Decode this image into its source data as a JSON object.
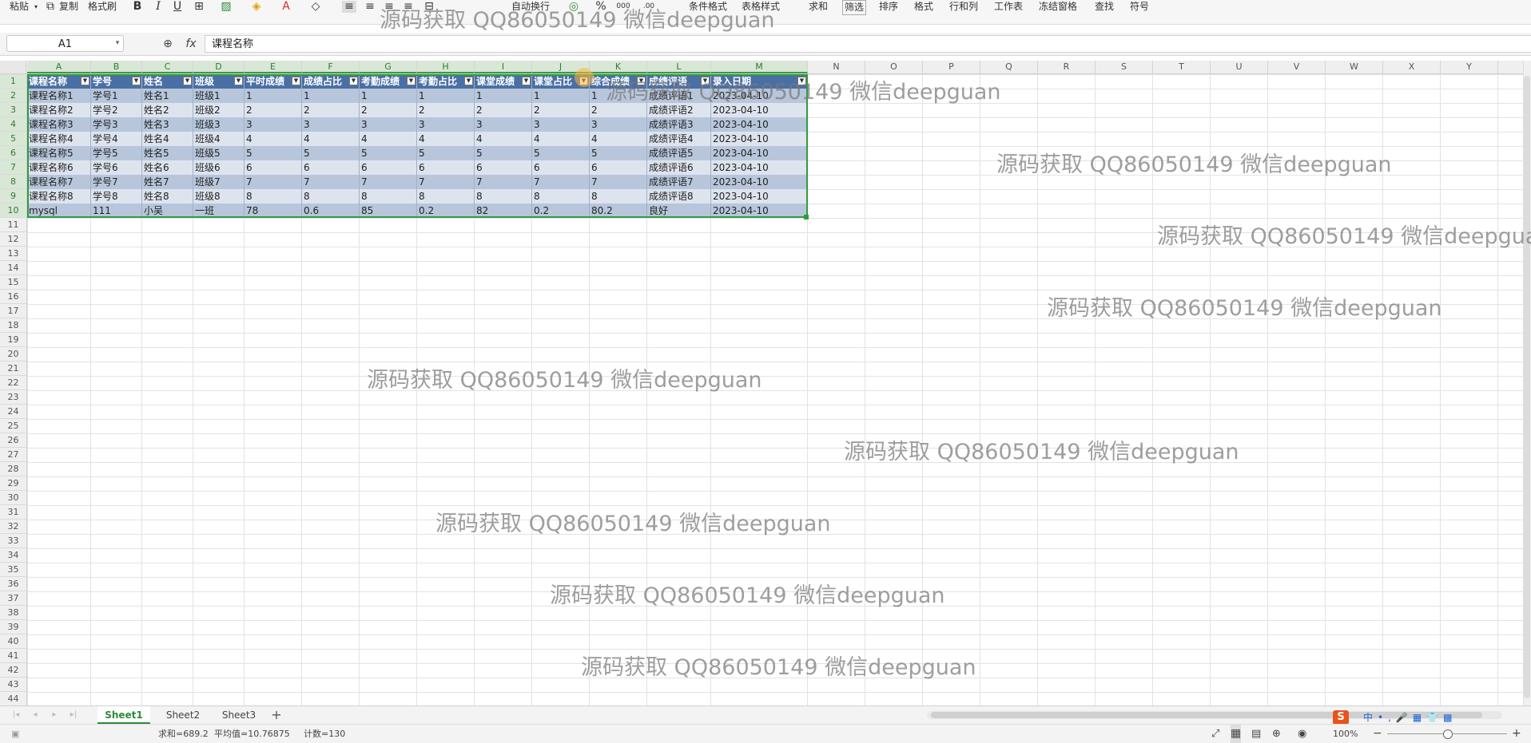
{
  "ribbon": {
    "paste": "粘贴",
    "copy": "复制",
    "format_painter": "格式刷",
    "wrap_text": "自动换行",
    "conditional_format": "条件格式",
    "table_style": "表格样式",
    "sum": "求和",
    "filter": "筛选",
    "sort": "排序",
    "format": "格式",
    "rows_cols": "行和列",
    "worksheet": "工作表",
    "freeze": "冻结窗格",
    "find": "查找",
    "symbol": "符号"
  },
  "formula_bar": {
    "name_box": "A1",
    "fx": "fx",
    "value": "课程名称"
  },
  "columns": [
    "A",
    "B",
    "C",
    "D",
    "E",
    "F",
    "G",
    "H",
    "I",
    "J",
    "K",
    "L",
    "M",
    "N",
    "O",
    "P",
    "Q",
    "R",
    "S",
    "T",
    "U",
    "V",
    "W",
    "X",
    "Y"
  ],
  "row_numbers": [
    "1",
    "2",
    "3",
    "4",
    "5",
    "6",
    "7",
    "8",
    "9",
    "10",
    "11",
    "12",
    "13",
    "14",
    "15",
    "16",
    "17",
    "18",
    "19",
    "20",
    "21",
    "22",
    "23",
    "24",
    "25",
    "26",
    "27",
    "28",
    "29",
    "30",
    "31",
    "32",
    "33",
    "34",
    "35",
    "36",
    "37",
    "38",
    "39",
    "40",
    "41",
    "42",
    "43",
    "44"
  ],
  "table": {
    "headers": [
      "课程名称",
      "学号",
      "姓名",
      "班级",
      "平时成绩",
      "成绩占比",
      "考勤成绩",
      "考勤占比",
      "课堂成绩",
      "课堂占比",
      "综合成绩",
      "成绩评语",
      "录入日期"
    ],
    "rows": [
      [
        "课程名称1",
        "学号1",
        "姓名1",
        "班级1",
        "1",
        "1",
        "1",
        "1",
        "1",
        "1",
        "1",
        "成绩评语1",
        "2023-04-10"
      ],
      [
        "课程名称2",
        "学号2",
        "姓名2",
        "班级2",
        "2",
        "2",
        "2",
        "2",
        "2",
        "2",
        "2",
        "成绩评语2",
        "2023-04-10"
      ],
      [
        "课程名称3",
        "学号3",
        "姓名3",
        "班级3",
        "3",
        "3",
        "3",
        "3",
        "3",
        "3",
        "3",
        "成绩评语3",
        "2023-04-10"
      ],
      [
        "课程名称4",
        "学号4",
        "姓名4",
        "班级4",
        "4",
        "4",
        "4",
        "4",
        "4",
        "4",
        "4",
        "成绩评语4",
        "2023-04-10"
      ],
      [
        "课程名称5",
        "学号5",
        "姓名5",
        "班级5",
        "5",
        "5",
        "5",
        "5",
        "5",
        "5",
        "5",
        "成绩评语5",
        "2023-04-10"
      ],
      [
        "课程名称6",
        "学号6",
        "姓名6",
        "班级6",
        "6",
        "6",
        "6",
        "6",
        "6",
        "6",
        "6",
        "成绩评语6",
        "2023-04-10"
      ],
      [
        "课程名称7",
        "学号7",
        "姓名7",
        "班级7",
        "7",
        "7",
        "7",
        "7",
        "7",
        "7",
        "7",
        "成绩评语7",
        "2023-04-10"
      ],
      [
        "课程名称8",
        "学号8",
        "姓名8",
        "班级8",
        "8",
        "8",
        "8",
        "8",
        "8",
        "8",
        "8",
        "成绩评语8",
        "2023-04-10"
      ],
      [
        "mysql",
        "111",
        "小吴",
        "一班",
        "78",
        "0.6",
        "85",
        "0.2",
        "82",
        "0.2",
        "80.2",
        "良好",
        "2023-04-10"
      ]
    ]
  },
  "watermark": "源码获取 QQ86050149 微信deepguan",
  "sheets": [
    {
      "name": "Sheet1",
      "active": true
    },
    {
      "name": "Sheet2",
      "active": false
    },
    {
      "name": "Sheet3",
      "active": false
    }
  ],
  "status": {
    "sum": "求和=689.2",
    "average": "平均值=10.76875",
    "count": "计数=130",
    "zoom": "100%"
  },
  "colors": {
    "table_header": "#4a6fa5",
    "row_band_dark": "#b7c6db",
    "row_band_light": "#dde4ee",
    "selection": "#2e9b3f"
  }
}
